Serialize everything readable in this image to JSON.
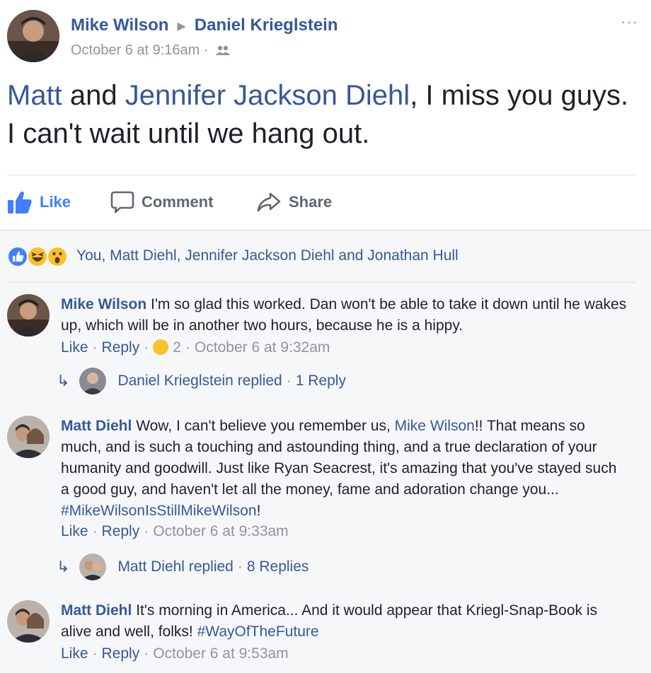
{
  "post": {
    "author": "Mike Wilson",
    "target": "Daniel Kriegl­stein",
    "timestamp": "October 6 at 9:16am",
    "meta_sep": "·",
    "text_mention_1": "Matt",
    "text_and": " and ",
    "text_mention_2": "Jennifer Jackson Diehl",
    "text_rest": ", I miss you guys. I can't wait until we hang out.",
    "more": "···"
  },
  "actions": {
    "like": "Like",
    "comment": "Comment",
    "share": "Share"
  },
  "reactions": {
    "text": "You, Matt Diehl, Jennifer Jackson Diehl and Jonathan Hull",
    "icons": [
      "like-icon",
      "haha-icon",
      "wow-icon"
    ]
  },
  "comments": [
    {
      "author": "Mike Wilson",
      "text": "I'm so glad this worked. Dan won't be able to take it down until he wakes up, which will be in another two hours, because he is a hippy.",
      "like": "Like",
      "reply": "Reply",
      "reaction_count": "2",
      "timestamp": "October 6 at 9:32am",
      "replies": {
        "name": "Daniel Krieglstein replied",
        "count": "1 Reply"
      }
    },
    {
      "author": "Matt Diehl",
      "text_1": "Wow, I can't believe you remember us, ",
      "mention": "Mike Wilson",
      "text_2": "!! That means so much, and is such a touching and astounding thing, and a true declaration of your humanity and goodwill. Just like Ryan Seacrest, it's amazing that you've stayed such a good guy, and haven't let all the money, fame and adoration change you... ",
      "hashtag": "#MikeWilsonIsStillMikeWilson",
      "text_3": "!",
      "like": "Like",
      "reply": "Reply",
      "timestamp": "October 6 at 9:33am",
      "replies": {
        "name": "Matt Diehl replied",
        "count": "8 Replies"
      }
    },
    {
      "author": "Matt Diehl",
      "text": "It's morning in America... And it would appear that Kriegl-Snap-Book is alive and well, folks! ",
      "hashtag": "#WayOfTheFuture",
      "like": "Like",
      "reply": "Reply",
      "timestamp": "October 6 at 9:53am"
    }
  ],
  "colors": {
    "link": "#365899",
    "muted": "#90949c",
    "like_blue": "#4080ff",
    "comments_bg": "#f6f7f9"
  }
}
